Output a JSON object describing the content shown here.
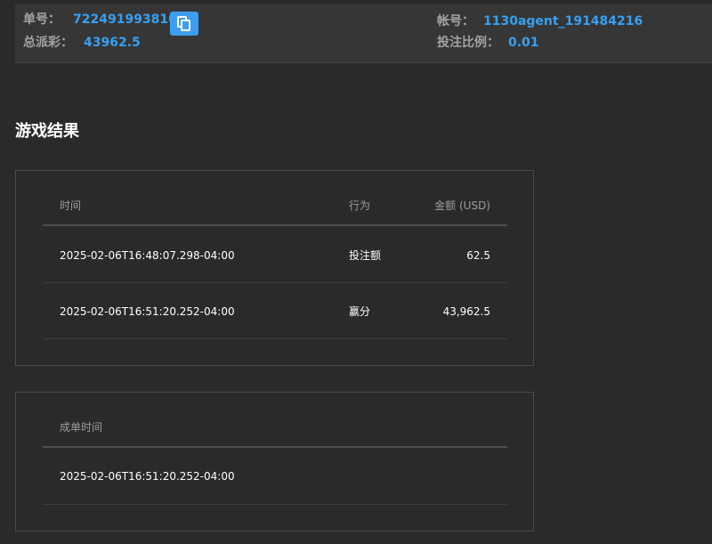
{
  "header": {
    "order_label": "单号：",
    "order_value": "722491993810",
    "payout_label": "总派彩：",
    "payout_value": "43962.5",
    "account_label": "帐号：",
    "account_value": "1130agent_191484216",
    "ratio_label": "投注比例：",
    "ratio_value": "0.01",
    "copy_icon": "copy-icon",
    "accent_color": "#36a0f2"
  },
  "section_title": "游戏结果",
  "results": {
    "columns": [
      "时间",
      "行为",
      "金额 (USD)"
    ],
    "rows": [
      {
        "time": "2025-02-06T16:48:07.298-04:00",
        "action": "投注额",
        "amount": "62.5"
      },
      {
        "time": "2025-02-06T16:51:20.252-04:00",
        "action": "赢分",
        "amount": "43,962.5"
      }
    ]
  },
  "settlement": {
    "column": "成单时间",
    "value": "2025-02-06T16:51:20.252-04:00"
  }
}
